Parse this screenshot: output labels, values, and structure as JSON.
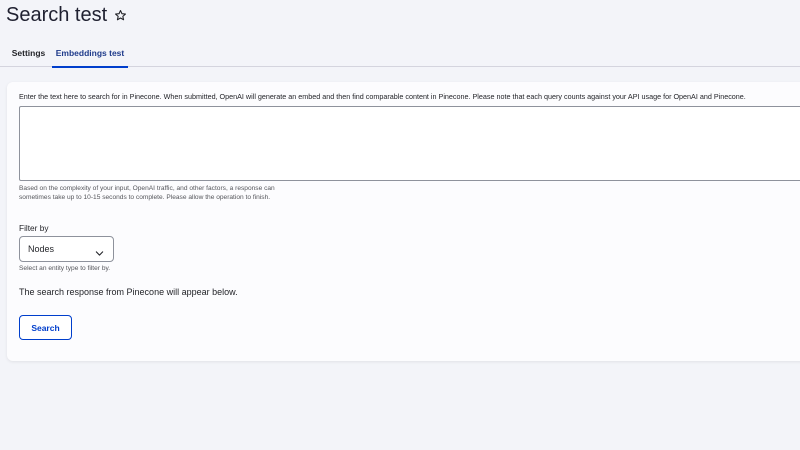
{
  "page": {
    "title": "Search test",
    "star_icon": "star-outline-icon"
  },
  "tabs": [
    {
      "label": "Settings",
      "active": false
    },
    {
      "label": "Embeddings test",
      "active": true
    }
  ],
  "form": {
    "query_label": "Enter the text here to search for in Pinecone. When submitted, OpenAI will generate an embed and then find comparable content in Pinecone. Please note that each query counts against your API usage for OpenAI and Pinecone.",
    "query_value": "",
    "query_description": "Based on the complexity of your input, OpenAI traffic, and other factors, a response can sometimes take up to 10-15 seconds to complete. Please allow the operation to finish.",
    "filter_label": "Filter by",
    "filter_selected": "Nodes",
    "filter_description": "Select an entity type to filter by.",
    "response_text": "The search response from Pinecone will appear below.",
    "search_button": "Search"
  },
  "colors": {
    "accent": "#003ecc",
    "background": "#f3f4f9",
    "card": "#fcfcfe"
  }
}
